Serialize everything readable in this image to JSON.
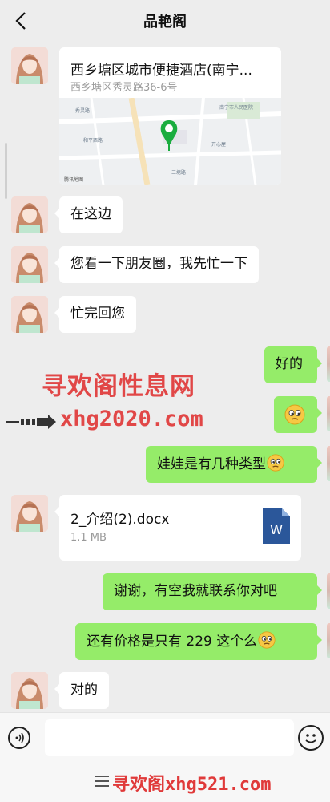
{
  "header": {
    "title": "品艳阁"
  },
  "location": {
    "name": "西乡塘区城市便捷酒店(南宁...",
    "address": "西乡塘区秀灵路36-6号",
    "map_labels": [
      "秀灵路36",
      "南宁市人民医院",
      "和平西路",
      "开心屋",
      "三塘路"
    ]
  },
  "messages": {
    "m1": "在这边",
    "m2": "您看一下朋友圈，我先忙一下",
    "m3": "忙完回您",
    "m4": "好的",
    "m6": "娃娃是有几种类型",
    "m8": "谢谢，有空我就联系你对吧",
    "m9": "还有价格是只有 229 这个么",
    "m10": "对的"
  },
  "file": {
    "name": "2_介绍(2).docx",
    "size": "1.1 MB",
    "icon_letter": "W"
  },
  "watermark": {
    "line1": "寻欢阁性息网",
    "line2": "xhg2020.com",
    "bottom": "寻欢阁xhg521.com"
  },
  "input": {
    "placeholder": ""
  },
  "colors": {
    "bubble_right": "#95ec69",
    "bubble_left": "#ffffff",
    "bg": "#ededed",
    "watermark": "#e03a3a"
  }
}
